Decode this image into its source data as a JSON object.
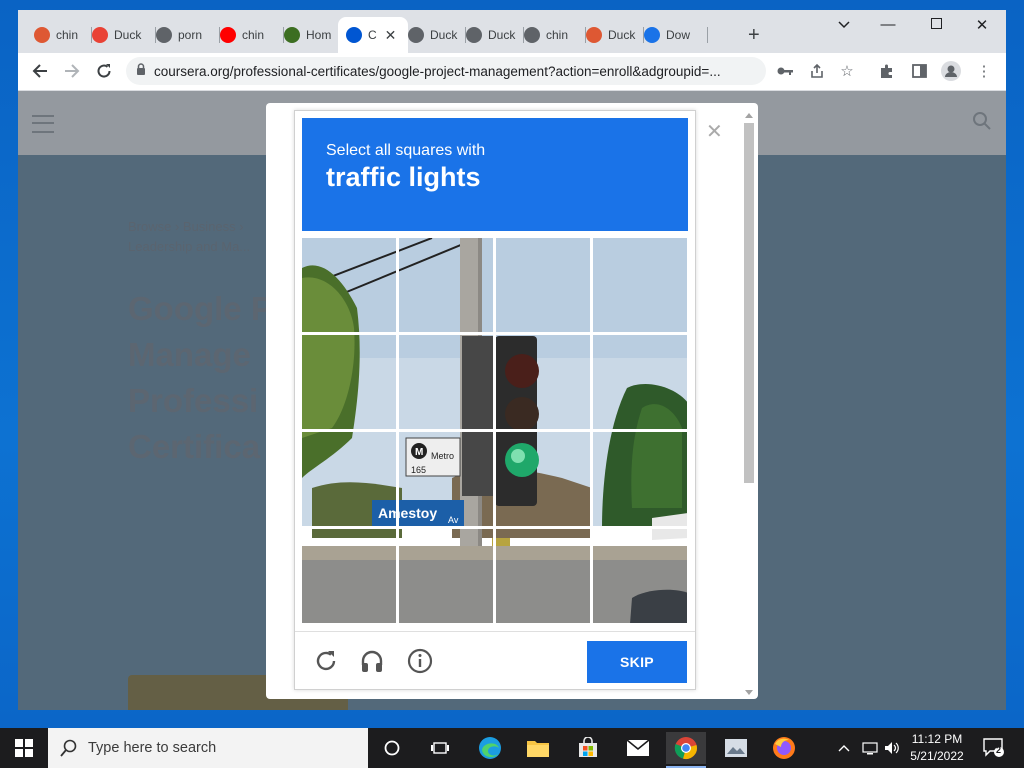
{
  "browser": {
    "tabs": [
      {
        "label": "chin",
        "icon": "duckduckgo-icon",
        "color": "#de5833"
      },
      {
        "label": "Duck",
        "icon": "rainbow-icon",
        "color": "#e94235"
      },
      {
        "label": "porn",
        "icon": "globe-icon",
        "color": "#5f6368"
      },
      {
        "label": "chin",
        "icon": "youtube-icon",
        "color": "#ff0000"
      },
      {
        "label": "Hom",
        "icon": "site-icon",
        "color": "#3c6e21"
      },
      {
        "label": "C",
        "icon": "coursera-icon",
        "color": "#0056d2",
        "close": "✕"
      },
      {
        "label": "Duck",
        "icon": "globe-icon",
        "color": "#5f6368"
      },
      {
        "label": "Duck",
        "icon": "globe-icon",
        "color": "#5f6368"
      },
      {
        "label": "chin",
        "icon": "globe-icon",
        "color": "#5f6368"
      },
      {
        "label": "Duck",
        "icon": "duckduckgo-icon",
        "color": "#de5833"
      },
      {
        "label": "Dow",
        "icon": "download-icon",
        "color": "#1a73e8"
      }
    ],
    "url": "coursera.org/professional-certificates/google-project-management?action=enroll&adgroupid=..."
  },
  "background_page": {
    "breadcrumb_line1": "Browse  ›  Business  ›",
    "breadcrumb_line2": "Leadership and Ma...",
    "title_lines": [
      "Google P",
      "Manage",
      "Professi",
      "Certifica"
    ]
  },
  "captcha": {
    "prompt_line1": "Select all squares with",
    "prompt_line2": "traffic lights",
    "skip_label": "SKIP",
    "sign_street": "Amestoy",
    "sign_av": "Av",
    "sign_metro": "Metro",
    "sign_m": "M",
    "sign_route": "165"
  },
  "taskbar": {
    "search_placeholder": "Type here to search",
    "time": "11:12 PM",
    "date": "5/21/2022",
    "notification_count": "2"
  },
  "colors": {
    "accent": "#1a73e8",
    "taskbar": "#1c1c1e",
    "desktop": "#0d72d2"
  }
}
